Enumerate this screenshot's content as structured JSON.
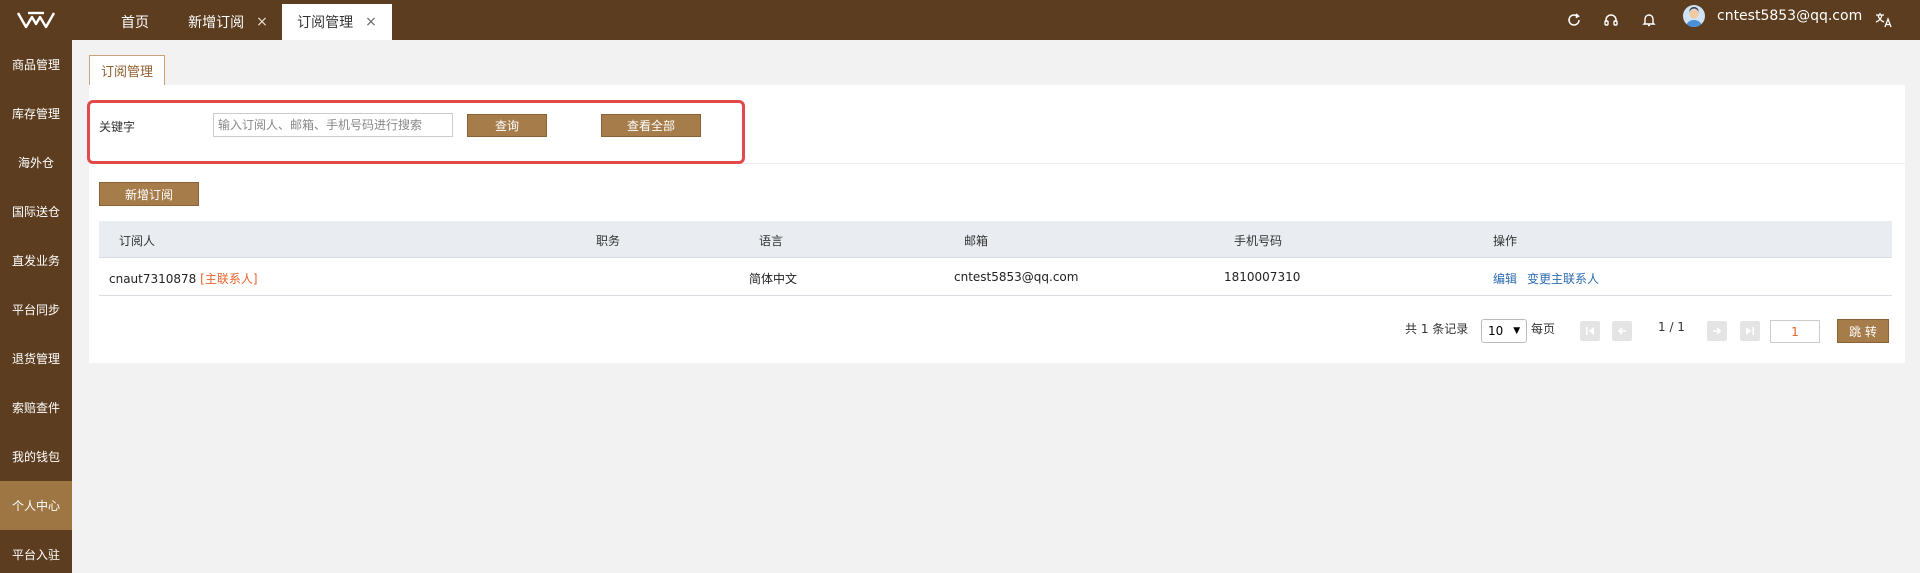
{
  "nav": {
    "tabs": [
      {
        "label": "首页"
      },
      {
        "label": "新增订阅",
        "close": "×"
      },
      {
        "label": "订阅管理",
        "close": "×"
      }
    ],
    "user_email": "cntest5853@qq.com"
  },
  "sidebar": {
    "items": [
      {
        "label": "商品管理"
      },
      {
        "label": "库存管理"
      },
      {
        "label": "海外仓"
      },
      {
        "label": "国际送仓"
      },
      {
        "label": "直发业务"
      },
      {
        "label": "平台同步"
      },
      {
        "label": "退货管理"
      },
      {
        "label": "索赔查件"
      },
      {
        "label": "我的钱包"
      },
      {
        "label": "个人中心"
      },
      {
        "label": "平台入驻"
      }
    ],
    "active_index": 9
  },
  "page": {
    "subtab": "订阅管理",
    "search": {
      "label": "关键字",
      "placeholder": "输入订阅人、邮箱、手机号码进行搜索",
      "query_button": "查询",
      "view_all_button": "查看全部"
    },
    "add_button": "新增订阅",
    "table": {
      "headers": [
        "订阅人",
        "职务",
        "语言",
        "邮箱",
        "手机号码",
        "操作"
      ],
      "rows": [
        {
          "subscriber": "cnaut7310878",
          "tag": "[主联系人]",
          "position": "",
          "language": "简体中文",
          "email": "cntest5853@qq.com",
          "phone": "1810007310",
          "actions": [
            "编辑",
            "变更主联系人"
          ]
        }
      ]
    },
    "pagination": {
      "total_text": "共 1 条记录",
      "page_size": "10",
      "per_page_label": "每页",
      "page_info": "1 / 1",
      "jump_value": "1",
      "jump_button": "跳 转"
    }
  },
  "colors": {
    "brand_dark": "#5c3d1f",
    "accent": "#a67c4a",
    "highlight": "#e04a4a",
    "tag": "#e8632b",
    "link": "#2b6cb0"
  }
}
